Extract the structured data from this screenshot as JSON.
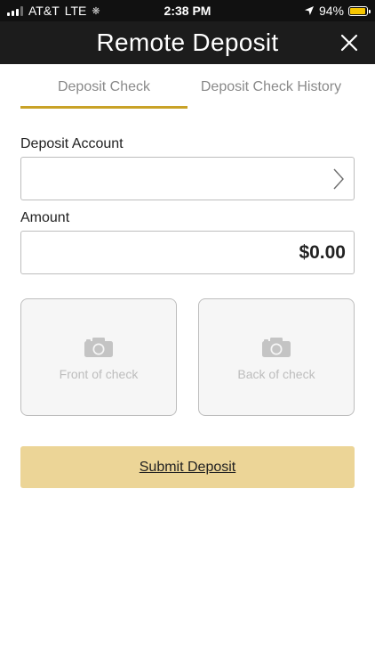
{
  "status_bar": {
    "carrier": "AT&T",
    "network": "LTE",
    "time": "2:38 PM",
    "battery": "94%",
    "battery_level": 0.94,
    "battery_color": "#f7c600"
  },
  "header": {
    "title": "Remote Deposit",
    "close_icon": "close-icon"
  },
  "tabs": [
    {
      "label": "Deposit Check",
      "active": true
    },
    {
      "label": "Deposit Check History",
      "active": false
    }
  ],
  "form": {
    "account_label": "Deposit Account",
    "account_value": "",
    "amount_label": "Amount",
    "amount_value": "$0.00"
  },
  "check_capture": {
    "front_label": "Front of check",
    "back_label": "Back of check",
    "icon": "camera-icon"
  },
  "submit_label": "Submit Deposit",
  "colors": {
    "accent": "#c9a227",
    "submit_background": "#ecd597",
    "header_background": "#1c1c1c"
  }
}
